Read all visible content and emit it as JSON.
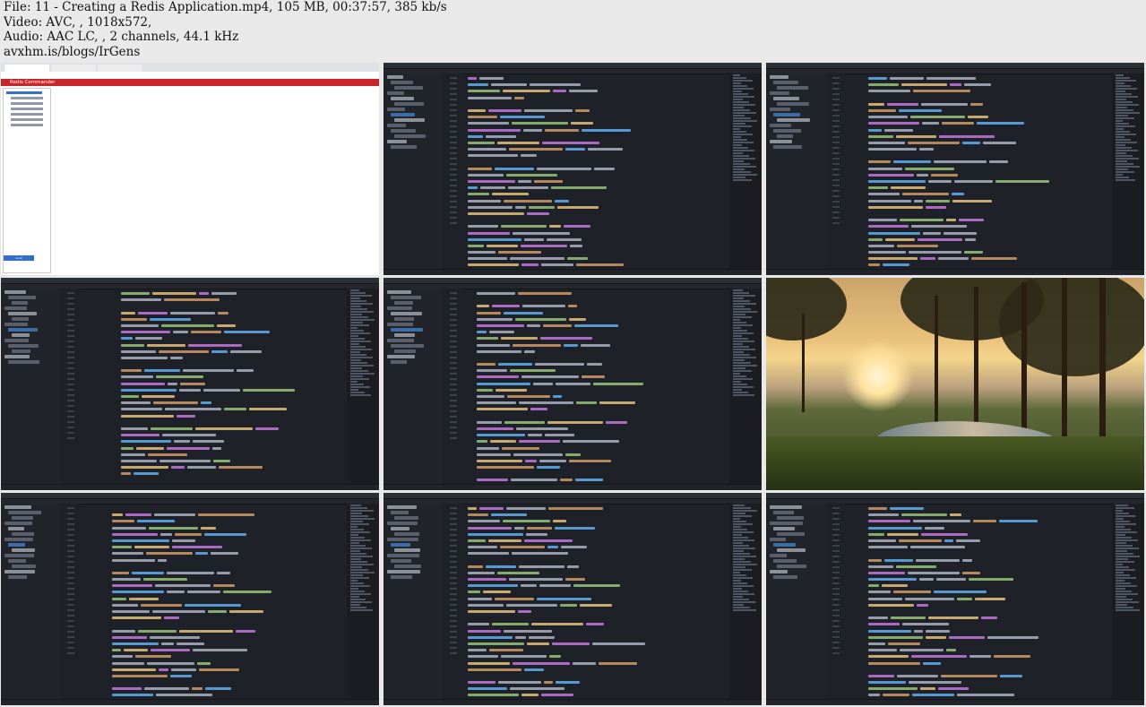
{
  "header": {
    "line1": "File: 11 - Creating a Redis Application.mp4, 105 MB, 00:37:57, 385 kb/s",
    "line2": "Video: AVC, , 1018x572,",
    "line3": "Audio: AAC LC, , 2 channels, 44.1 kHz",
    "line4": "avxhm.is/blogs/IrGens"
  },
  "browser_thumb": {
    "app_title": "Redis Commander",
    "button_label": "local (localhost:6379:0)"
  },
  "colors": {
    "keyword": "#c678dd",
    "function": "#61afef",
    "string": "#98c379",
    "plain": "#abb2bf",
    "type": "#e5c07b",
    "number": "#d19a66",
    "comment": "#5c6370"
  }
}
